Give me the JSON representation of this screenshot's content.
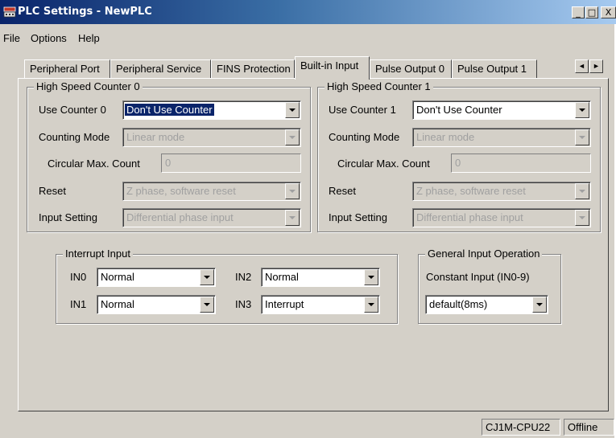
{
  "window": {
    "title": "PLC Settings - NewPLC",
    "icon": "plc-settings-icon",
    "buttons": {
      "minimize": "_",
      "maximize": "□",
      "close": "X"
    }
  },
  "menu": [
    "File",
    "Options",
    "Help"
  ],
  "tabs": [
    "Peripheral Port",
    "Peripheral Service",
    "FINS Protection",
    "Built-in Input",
    "Pulse Output 0",
    "Pulse Output 1"
  ],
  "active_tab": "Built-in Input",
  "tab_scroll": {
    "left": "◄",
    "right": "►"
  },
  "hsc0": {
    "title": "High Speed Counter 0",
    "use_label": "Use Counter 0",
    "use_value": "Don't Use Counter",
    "mode_label": "Counting Mode",
    "mode_value": "Linear mode",
    "circular_label": "Circular Max. Count",
    "circular_value": "0",
    "reset_label": "Reset",
    "reset_value": "Z phase, software reset",
    "input_label": "Input Setting",
    "input_value": "Differential phase input"
  },
  "hsc1": {
    "title": "High Speed Counter 1",
    "use_label": "Use Counter 1",
    "use_value": "Don't Use Counter",
    "mode_label": "Counting Mode",
    "mode_value": "Linear mode",
    "circular_label": "Circular Max. Count",
    "circular_value": "0",
    "reset_label": "Reset",
    "reset_value": "Z phase, software reset",
    "input_label": "Input Setting",
    "input_value": "Differential phase input"
  },
  "interrupt": {
    "title": "Interrupt Input",
    "in0_label": "IN0",
    "in0_value": "Normal",
    "in1_label": "IN1",
    "in1_value": "Normal",
    "in2_label": "IN2",
    "in2_value": "Normal",
    "in3_label": "IN3",
    "in3_value": "Interrupt"
  },
  "general": {
    "title": "General Input Operation",
    "const_label": "Constant Input (IN0-9)",
    "const_value": "default(8ms)"
  },
  "status": {
    "model": "CJ1M-CPU22",
    "mode": "Offline"
  }
}
